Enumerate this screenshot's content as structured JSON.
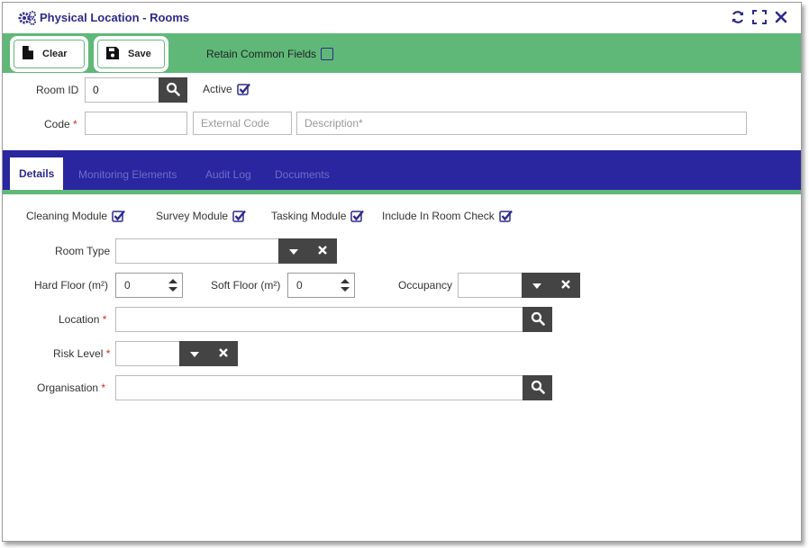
{
  "window": {
    "title": "Physical Location - Rooms"
  },
  "toolbar": {
    "clear_label": "Clear",
    "save_label": "Save",
    "retain_label": "Retain Common Fields"
  },
  "header": {
    "room_id_label": "Room ID",
    "room_id_value": "0",
    "active_label": "Active",
    "code_label": "Code",
    "external_code_placeholder": "External Code",
    "description_placeholder": "Description*"
  },
  "tabs": [
    "Details",
    "Monitoring Elements",
    "Audit Log",
    "Documents"
  ],
  "modules": {
    "cleaning": "Cleaning Module",
    "survey": "Survey Module",
    "tasking": "Tasking Module",
    "room_check": "Include In Room Check"
  },
  "details": {
    "room_type_label": "Room Type",
    "hard_floor_label": "Hard Floor (m²)",
    "hard_floor_value": "0",
    "soft_floor_label": "Soft Floor (m²)",
    "soft_floor_value": "0",
    "occupancy_label": "Occupancy",
    "location_label": "Location",
    "risk_level_label": "Risk Level",
    "organisation_label": "Organisation",
    "required_mark": "*"
  },
  "colors": {
    "accent": "#2a26a0",
    "toolbar_green": "#5fb878",
    "required": "#d9261c",
    "dark_button": "#444444"
  }
}
